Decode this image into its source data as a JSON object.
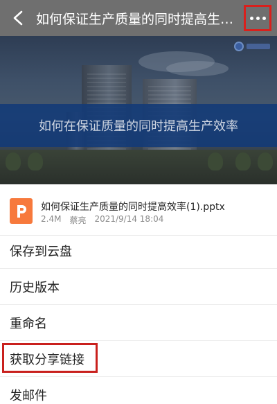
{
  "header": {
    "title": "如何保证生产质量的同时提高生产效率"
  },
  "preview": {
    "banner_text": "如何在保证质量的同时提高生产效率"
  },
  "file": {
    "name": "如何保证生产质量的同时提高效率(1).pptx",
    "size": "2.4M",
    "owner": "蔡亮",
    "modified": "2021/9/14 18:04"
  },
  "menu": {
    "items": [
      {
        "label": "保存到云盘"
      },
      {
        "label": "历史版本"
      },
      {
        "label": "重命名"
      },
      {
        "label": "获取分享链接"
      },
      {
        "label": "发邮件"
      }
    ]
  },
  "colors": {
    "highlight": "#d9201c",
    "ppt_icon": "#f7793c",
    "banner": "#123a78"
  }
}
